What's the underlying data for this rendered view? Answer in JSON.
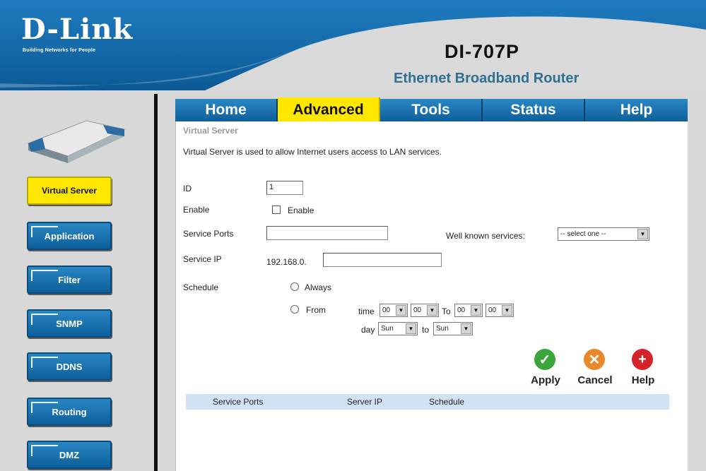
{
  "header": {
    "logo": "D-Link",
    "logo_tagline": "Building Networks for People",
    "model": "DI-707P",
    "model_subtitle": "Ethernet Broadband Router"
  },
  "tabs": [
    {
      "label": "Home",
      "active": false
    },
    {
      "label": "Advanced",
      "active": true
    },
    {
      "label": "Tools",
      "active": false
    },
    {
      "label": "Status",
      "active": false
    },
    {
      "label": "Help",
      "active": false
    }
  ],
  "sidebar": {
    "items": [
      {
        "label": "Virtual Server",
        "active": true
      },
      {
        "label": "Application",
        "active": false
      },
      {
        "label": "Filter",
        "active": false
      },
      {
        "label": "SNMP",
        "active": false
      },
      {
        "label": "DDNS",
        "active": false
      },
      {
        "label": "Routing",
        "active": false
      },
      {
        "label": "DMZ",
        "active": false
      }
    ]
  },
  "content": {
    "title": "Virtual Server",
    "description": "Virtual Server is used to allow Internet users access to LAN services.",
    "form": {
      "id_label": "ID",
      "id_value": "1",
      "enable_label": "Enable",
      "enable_checkbox_label": "Enable",
      "service_ports_label": "Service Ports",
      "service_ports_value": "",
      "well_known_label": "Well known services:",
      "well_known_selected": "-- select one --",
      "service_ip_label": "Service IP",
      "service_ip_prefix": "192.168.0.",
      "service_ip_value": "",
      "schedule_label": "Schedule",
      "always_label": "Always",
      "from_label": "From",
      "time_label": "time",
      "to_label": "To",
      "day_label": "day",
      "day_to_label": "to",
      "time_from_hour": "00",
      "time_from_min": "00",
      "time_to_hour": "00",
      "time_to_min": "00",
      "day_from": "Sun",
      "day_to": "Sun"
    },
    "actions": [
      {
        "label": "Apply",
        "color": "#3aa53a",
        "glyph": "✓"
      },
      {
        "label": "Cancel",
        "color": "#e8882a",
        "glyph": "✕"
      },
      {
        "label": "Help",
        "color": "#d4232a",
        "glyph": "+"
      }
    ],
    "table_headers": [
      "Service Ports",
      "Server IP",
      "Schedule"
    ]
  }
}
